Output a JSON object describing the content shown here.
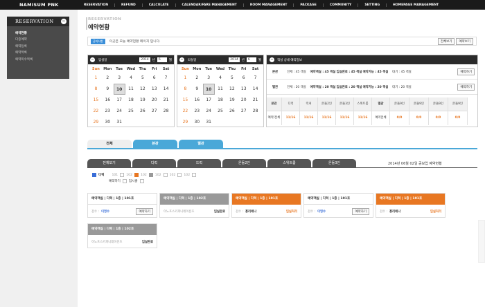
{
  "header": {
    "logo": "NAMISUM PNK",
    "nav": [
      "RESERVATION",
      "REFUND",
      "CALCULATE",
      "CALENDAR/FARE MANAGEMENT",
      "ROOM MANAGEMENT",
      "PACKAGE",
      "COMMUNITY",
      "SETTING",
      "HOMEPAGE MANAGEMENT"
    ]
  },
  "sidebar": {
    "title": "RESERVATION",
    "collapse_icon": "minus",
    "items": [
      "예약현황",
      "다중예약",
      "예약등록",
      "예약목록",
      "예약미수목록"
    ]
  },
  "page": {
    "subtitle": "RESERVATION",
    "title": "예약현황"
  },
  "notice": {
    "tag": "공지사항",
    "text": "이곳은 오늘 예약현황 페이지 입니다.",
    "btn_print": "전체보기",
    "btn_save": "예약보기"
  },
  "calendars": [
    {
      "label": "입실일",
      "year": "2014",
      "year_unit": "년",
      "month": "6",
      "month_unit": "월",
      "dow": [
        "Sun",
        "Mon",
        "Tue",
        "Wed",
        "Thu",
        "Fri",
        "Sat"
      ],
      "days": [
        "",
        "",
        "",
        "",
        "",
        "",
        "",
        "1",
        "2",
        "3",
        "4",
        "5",
        "6",
        "7",
        "8",
        "9",
        "10",
        "11",
        "12",
        "13",
        "14",
        "15",
        "16",
        "17",
        "18",
        "19",
        "20",
        "21",
        "22",
        "23",
        "24",
        "25",
        "26",
        "27",
        "28",
        "29",
        "30",
        "31",
        "",
        "",
        "",
        ""
      ],
      "today": "10"
    },
    {
      "label": "퇴실일",
      "year": "2014",
      "year_unit": "년",
      "month": "6",
      "month_unit": "월",
      "dow": [
        "Sun",
        "Mon",
        "Tue",
        "Wed",
        "Thu",
        "Fri",
        "Sat"
      ],
      "days": [
        "",
        "",
        "",
        "",
        "",
        "",
        "",
        "1",
        "2",
        "3",
        "4",
        "5",
        "6",
        "7",
        "8",
        "9",
        "10",
        "11",
        "12",
        "13",
        "14",
        "15",
        "16",
        "17",
        "18",
        "19",
        "20",
        "21",
        "22",
        "23",
        "24",
        "25",
        "26",
        "27",
        "28",
        "29",
        "30",
        "31",
        "",
        "",
        "",
        ""
      ],
      "today": "10"
    }
  ],
  "reservation_info": {
    "title": "객실 상세 예약정보",
    "rows": [
      {
        "label": "본관",
        "total": "전체 : 45 객실",
        "avail": "예약객실 : 45 객실",
        "checkin": "입실완료 : 45 객실",
        "possible": "예약가능 : 45 객실",
        "wait": "대기 : 45 객실",
        "btn": "예약하기"
      },
      {
        "label": "별관",
        "total": "전체 : 20 객실",
        "avail": "예약객실 : 20 객실",
        "checkin": "입실완료 : 20 객실",
        "possible": "예약가능 : 20 객실",
        "wait": "대기 : 20 객실",
        "btn": "예약하기"
      }
    ],
    "table": {
      "cols": [
        "본관",
        "디럭",
        "럭셔",
        "온돌2인",
        "온돌3인",
        "스위트룸",
        "별관",
        "온돌9인",
        "온돌9인",
        "온돌9인",
        "온돌9인"
      ],
      "row_label": "예약/전체",
      "values": [
        "",
        "11/16",
        "11/16",
        "11/16",
        "11/16",
        "11/16",
        "예약전체",
        "0/0",
        "0/0",
        "0/0",
        "0/0"
      ]
    }
  },
  "tabs1": [
    "전체",
    "본관",
    "별관"
  ],
  "tabs2": [
    "전체보기",
    "디럭",
    "드럭",
    "온돌2인",
    "스위트룸",
    "온돌3인"
  ],
  "date_label": "2014년 06월 02일 공보업 예약현황",
  "legend": {
    "group": "디럭",
    "rooms": [
      "101",
      "102",
      "102",
      "102",
      "102",
      "102"
    ],
    "row2": [
      "예약하기",
      "입시출"
    ]
  },
  "cards": [
    {
      "title": "예약객실 | 디럭 | 1층 | 101호",
      "style": "white",
      "guest_label": "검수 :",
      "guest": "이영수",
      "status": "예약하기",
      "status_style": "btn"
    },
    {
      "title": "예약객실 | 디럭 | 1층 | 102호",
      "style": "gray",
      "guest_label": "",
      "guest": "이노프스카피니레이션즈",
      "status": "입실완료",
      "status_style": "bold"
    },
    {
      "title": "예약객실 | 디럭 | 1층 | 101호",
      "style": "orange",
      "guest_label": "검수 :",
      "guest": "홍리에나",
      "status": "입실처리",
      "status_style": "orange"
    },
    {
      "title": "예약객실 | 디럭 | 1층 | 101호",
      "style": "white",
      "guest_label": "검수 :",
      "guest": "이영수",
      "status": "예약하기",
      "status_style": "btn"
    },
    {
      "title": "예약객실 | 디럭 | 1층 | 101호",
      "style": "orange",
      "guest_label": "검수 :",
      "guest": "홍리에나",
      "status": "입실처리",
      "status_style": "orange"
    },
    {
      "title": "예약객실 | 디럭 | 1층 | 102호",
      "style": "gray",
      "guest_label": "",
      "guest": "이노프스카피니레이션즈",
      "status": "입실완료",
      "status_style": "bold"
    }
  ]
}
